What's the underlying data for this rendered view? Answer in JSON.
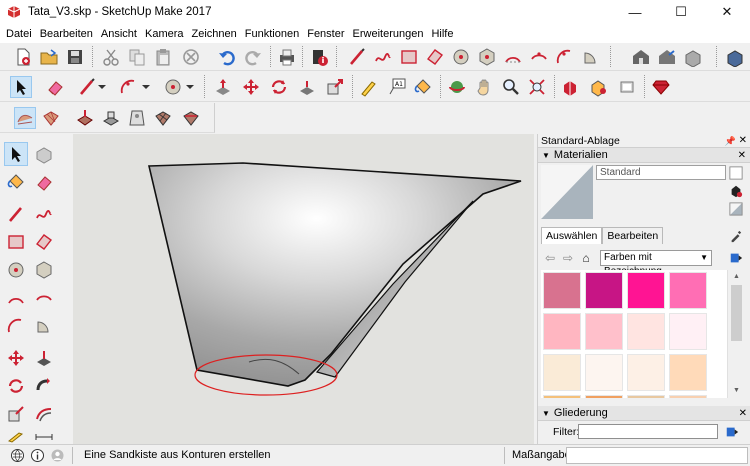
{
  "window": {
    "title": "Tata_V3.skp - SketchUp Make 2017",
    "controls": [
      "—",
      "☐",
      "✕"
    ]
  },
  "menu": [
    "Datei",
    "Bearbeiten",
    "Ansicht",
    "Kamera",
    "Zeichnen",
    "Funktionen",
    "Fenster",
    "Erweiterungen",
    "Hilfe"
  ],
  "panel": {
    "title": "Standard-Ablage",
    "materials": {
      "header": "Materialien",
      "current_name": "Standard",
      "tabs": [
        "Auswählen",
        "Bearbeiten"
      ],
      "library": "Farben mit Bezeichnung",
      "swatch_colors": [
        "#d8728f",
        "#c71585",
        "#ff1493",
        "#ff6eb4",
        "#ffb6c1",
        "#ffc0cb",
        "#ffe4e1",
        "#fff0f5",
        "#faebd7",
        "#fdf5f0",
        "#fdf0e6",
        "#ffdab9",
        "#f4c07a",
        "#f0a060",
        "#e8c8a0",
        "#f8d0b0"
      ]
    },
    "outliner": {
      "header": "Gliederung",
      "filter_label": "Filter:",
      "filter_value": ""
    }
  },
  "status": {
    "hint": "Eine Sandkiste aus Konturen erstellen",
    "measurements_label": "Maßangaben",
    "measurements_value": ""
  },
  "colors": {
    "accent": "#cc2233",
    "viewport_bg": "#e2e2df",
    "selection_ellipse": "#dd2020"
  }
}
